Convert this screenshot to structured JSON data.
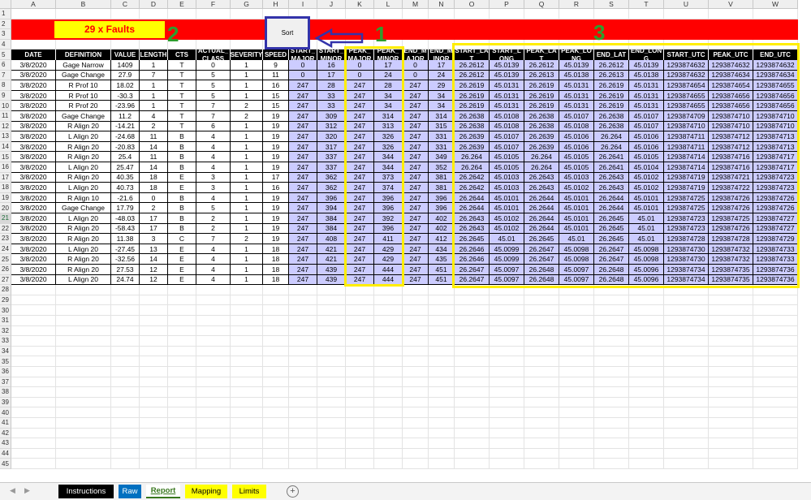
{
  "column_letters": [
    "A",
    "B",
    "C",
    "D",
    "E",
    "F",
    "G",
    "H",
    "I",
    "J",
    "K",
    "L",
    "M",
    "N",
    "O",
    "P",
    "Q",
    "R",
    "S",
    "T",
    "U",
    "V",
    "W"
  ],
  "row_numbers": [
    "1",
    "2",
    "3",
    "4",
    "5",
    "6",
    "7",
    "8",
    "9",
    "10",
    "11",
    "12",
    "13",
    "14",
    "15",
    "16",
    "17",
    "18",
    "19",
    "20",
    "21",
    "22",
    "23",
    "24",
    "25",
    "26",
    "27",
    "28",
    "29",
    "30",
    "31",
    "32",
    "33",
    "34",
    "35",
    "36",
    "37",
    "38",
    "39",
    "40",
    "41",
    "42",
    "43",
    "44",
    "45"
  ],
  "active_row": "21",
  "banner": {
    "text": "29 x Faults"
  },
  "sort_button": {
    "label": "Sort"
  },
  "annotations": {
    "n1": "1",
    "n2": "2",
    "n3": "3"
  },
  "headers": [
    "DATE",
    "DEFINITION",
    "VALUE",
    "LENGTH",
    "CTS",
    "ACTUAL_ CLASS",
    "SEVERITY",
    "SPEED",
    "START_ MAJOR",
    "START_ MINOR",
    "PEAK_ MAJOR",
    "PEAK_ MINOR",
    "END_M AJOR",
    "END_M INOR",
    "START_LA T",
    "START_L ONG",
    "PEAK_LA T",
    "PEAK_LO NG",
    "END_LAT",
    "END_LON G",
    "START_UTC",
    "PEAK_UTC",
    "END_UTC"
  ],
  "rows": [
    [
      "3/8/2020",
      "Gage Narrow",
      "1409",
      "1",
      "T",
      "0",
      "1",
      "9",
      "0",
      "16",
      "0",
      "17",
      "0",
      "17",
      "26.2612",
      "45.0139",
      "26.2612",
      "45.0139",
      "26.2612",
      "45.0139",
      "1293874632",
      "1293874632",
      "1293874632"
    ],
    [
      "3/8/2020",
      "Gage Change",
      "27.9",
      "7",
      "T",
      "5",
      "1",
      "11",
      "0",
      "17",
      "0",
      "24",
      "0",
      "24",
      "26.2612",
      "45.0139",
      "26.2613",
      "45.0138",
      "26.2613",
      "45.0138",
      "1293874632",
      "1293874634",
      "1293874634"
    ],
    [
      "3/8/2020",
      "R Prof 10",
      "18.02",
      "1",
      "T",
      "5",
      "1",
      "16",
      "247",
      "28",
      "247",
      "28",
      "247",
      "29",
      "26.2619",
      "45.0131",
      "26.2619",
      "45.0131",
      "26.2619",
      "45.0131",
      "1293874654",
      "1293874654",
      "1293874655"
    ],
    [
      "3/8/2020",
      "R Prof 10",
      "-30.3",
      "1",
      "T",
      "5",
      "1",
      "15",
      "247",
      "33",
      "247",
      "34",
      "247",
      "34",
      "26.2619",
      "45.0131",
      "26.2619",
      "45.0131",
      "26.2619",
      "45.0131",
      "1293874655",
      "1293874656",
      "1293874656"
    ],
    [
      "3/8/2020",
      "R Prof 20",
      "-23.96",
      "1",
      "T",
      "7",
      "2",
      "15",
      "247",
      "33",
      "247",
      "34",
      "247",
      "34",
      "26.2619",
      "45.0131",
      "26.2619",
      "45.0131",
      "26.2619",
      "45.0131",
      "1293874655",
      "1293874656",
      "1293874656"
    ],
    [
      "3/8/2020",
      "Gage Change",
      "11.2",
      "4",
      "T",
      "7",
      "2",
      "19",
      "247",
      "309",
      "247",
      "314",
      "247",
      "314",
      "26.2638",
      "45.0108",
      "26.2638",
      "45.0107",
      "26.2638",
      "45.0107",
      "1293874709",
      "1293874710",
      "1293874710"
    ],
    [
      "3/8/2020",
      "R Align 20",
      "-14.21",
      "2",
      "T",
      "6",
      "1",
      "19",
      "247",
      "312",
      "247",
      "313",
      "247",
      "315",
      "26.2638",
      "45.0108",
      "26.2638",
      "45.0108",
      "26.2638",
      "45.0107",
      "1293874710",
      "1293874710",
      "1293874710"
    ],
    [
      "3/8/2020",
      "L Align 20",
      "-24.68",
      "11",
      "B",
      "4",
      "1",
      "19",
      "247",
      "320",
      "247",
      "326",
      "247",
      "331",
      "26.2639",
      "45.0107",
      "26.2639",
      "45.0106",
      "26.264",
      "45.0106",
      "1293874711",
      "1293874712",
      "1293874713"
    ],
    [
      "3/8/2020",
      "R Align 20",
      "-20.83",
      "14",
      "B",
      "4",
      "1",
      "19",
      "247",
      "317",
      "247",
      "326",
      "247",
      "331",
      "26.2639",
      "45.0107",
      "26.2639",
      "45.0106",
      "26.264",
      "45.0106",
      "1293874711",
      "1293874712",
      "1293874713"
    ],
    [
      "3/8/2020",
      "R Align 20",
      "25.4",
      "11",
      "B",
      "4",
      "1",
      "19",
      "247",
      "337",
      "247",
      "344",
      "247",
      "349",
      "26.264",
      "45.0105",
      "26.264",
      "45.0105",
      "26.2641",
      "45.0105",
      "1293874714",
      "1293874716",
      "1293874717"
    ],
    [
      "3/8/2020",
      "L Align 20",
      "25.47",
      "14",
      "B",
      "4",
      "1",
      "19",
      "247",
      "337",
      "247",
      "344",
      "247",
      "352",
      "26.264",
      "45.0105",
      "26.264",
      "45.0105",
      "26.2641",
      "45.0104",
      "1293874714",
      "1293874716",
      "1293874717"
    ],
    [
      "3/8/2020",
      "R Align 20",
      "40.35",
      "18",
      "E",
      "3",
      "1",
      "17",
      "247",
      "362",
      "247",
      "373",
      "247",
      "381",
      "26.2642",
      "45.0103",
      "26.2643",
      "45.0103",
      "26.2643",
      "45.0102",
      "1293874719",
      "1293874721",
      "1293874723"
    ],
    [
      "3/8/2020",
      "L Align 20",
      "40.73",
      "18",
      "E",
      "3",
      "1",
      "16",
      "247",
      "362",
      "247",
      "374",
      "247",
      "381",
      "26.2642",
      "45.0103",
      "26.2643",
      "45.0102",
      "26.2643",
      "45.0102",
      "1293874719",
      "1293874722",
      "1293874723"
    ],
    [
      "3/8/2020",
      "R Align 10",
      "-21.6",
      "0",
      "B",
      "4",
      "1",
      "19",
      "247",
      "396",
      "247",
      "396",
      "247",
      "396",
      "26.2644",
      "45.0101",
      "26.2644",
      "45.0101",
      "26.2644",
      "45.0101",
      "1293874725",
      "1293874726",
      "1293874726"
    ],
    [
      "3/8/2020",
      "Gage Change",
      "17.79",
      "2",
      "B",
      "5",
      "1",
      "19",
      "247",
      "394",
      "247",
      "396",
      "247",
      "396",
      "26.2644",
      "45.0101",
      "26.2644",
      "45.0101",
      "26.2644",
      "45.0101",
      "1293874725",
      "1293874726",
      "1293874726"
    ],
    [
      "3/8/2020",
      "L Align 20",
      "-48.03",
      "17",
      "B",
      "2",
      "1",
      "19",
      "247",
      "384",
      "247",
      "392",
      "247",
      "402",
      "26.2643",
      "45.0102",
      "26.2644",
      "45.0101",
      "26.2645",
      "45.01",
      "1293874723",
      "1293874725",
      "1293874727"
    ],
    [
      "3/8/2020",
      "R Align 20",
      "-58.43",
      "17",
      "B",
      "2",
      "1",
      "19",
      "247",
      "384",
      "247",
      "396",
      "247",
      "402",
      "26.2643",
      "45.0102",
      "26.2644",
      "45.0101",
      "26.2645",
      "45.01",
      "1293874723",
      "1293874726",
      "1293874727"
    ],
    [
      "3/8/2020",
      "R Align 20",
      "11.38",
      "3",
      "C",
      "7",
      "2",
      "19",
      "247",
      "408",
      "247",
      "411",
      "247",
      "412",
      "26.2645",
      "45.01",
      "26.2645",
      "45.01",
      "26.2645",
      "45.01",
      "1293874728",
      "1293874728",
      "1293874729"
    ],
    [
      "3/8/2020",
      "L Align 20",
      "-27.45",
      "13",
      "E",
      "4",
      "1",
      "18",
      "247",
      "421",
      "247",
      "429",
      "247",
      "434",
      "26.2646",
      "45.0099",
      "26.2647",
      "45.0098",
      "26.2647",
      "45.0098",
      "1293874730",
      "1293874732",
      "1293874733"
    ],
    [
      "3/8/2020",
      "R Align 20",
      "-32.56",
      "14",
      "E",
      "4",
      "1",
      "18",
      "247",
      "421",
      "247",
      "429",
      "247",
      "435",
      "26.2646",
      "45.0099",
      "26.2647",
      "45.0098",
      "26.2647",
      "45.0098",
      "1293874730",
      "1293874732",
      "1293874733"
    ],
    [
      "3/8/2020",
      "R Align 20",
      "27.53",
      "12",
      "E",
      "4",
      "1",
      "18",
      "247",
      "439",
      "247",
      "444",
      "247",
      "451",
      "26.2647",
      "45.0097",
      "26.2648",
      "45.0097",
      "26.2648",
      "45.0096",
      "1293874734",
      "1293874735",
      "1293874736"
    ],
    [
      "3/8/2020",
      "L Align 20",
      "24.74",
      "12",
      "E",
      "4",
      "1",
      "18",
      "247",
      "439",
      "247",
      "444",
      "247",
      "451",
      "26.2647",
      "45.0097",
      "26.2648",
      "45.0097",
      "26.2648",
      "45.0096",
      "1293874734",
      "1293874735",
      "1293874736"
    ]
  ],
  "sheet_tabs": [
    {
      "name": "Instructions",
      "bg": "#000000",
      "fg": "#ffffff"
    },
    {
      "name": "Raw",
      "bg": "#0070c0",
      "fg": "#ffffff"
    },
    {
      "name": "Report",
      "bg": "#ffffff",
      "fg": "#38761d"
    },
    {
      "name": "Mapping",
      "bg": "#ffff00",
      "fg": "#000000"
    },
    {
      "name": "Limits",
      "bg": "#ffff00",
      "fg": "#000000"
    }
  ],
  "active_tab": "Report",
  "add_sheet_icon": "plus-circle-icon",
  "colors": {
    "banner_red": "#ff0000",
    "highlight_lavender": "#ccccff",
    "annotation_green": "#2e9e2e",
    "box_yellow": "#ffee00"
  }
}
